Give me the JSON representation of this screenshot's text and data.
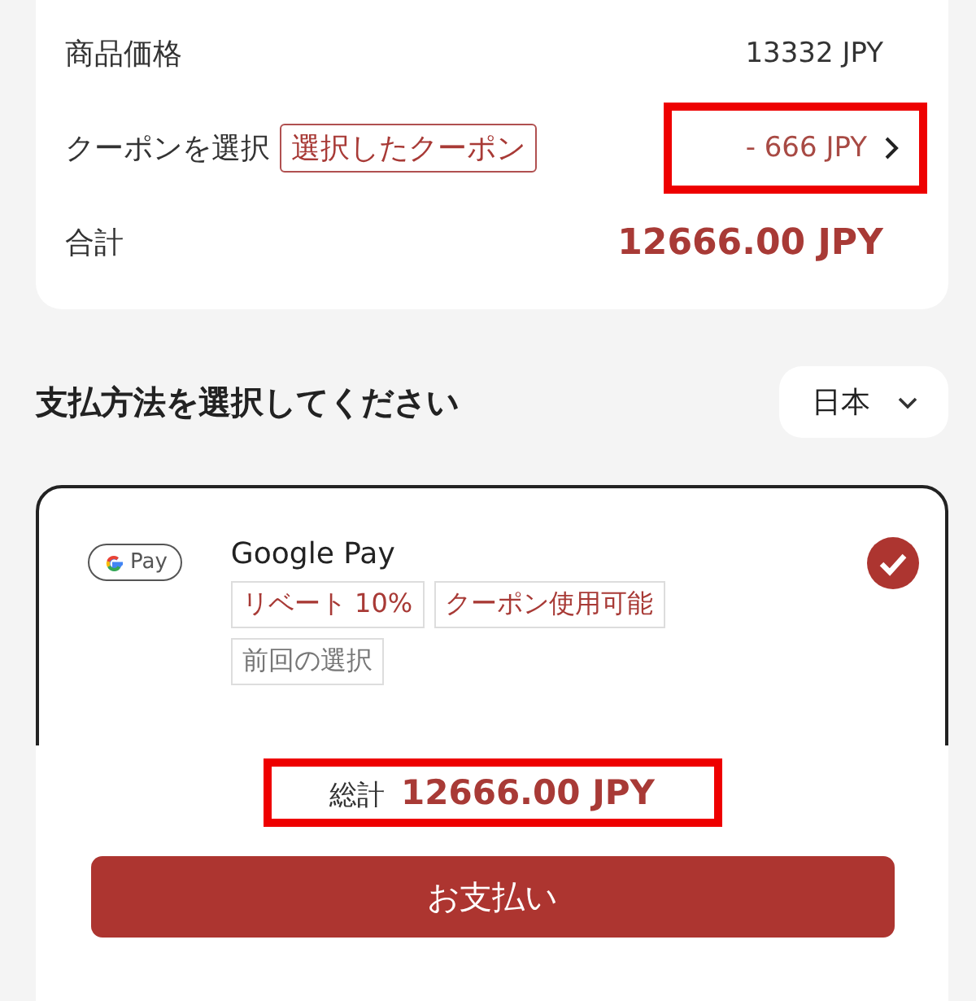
{
  "summary": {
    "rows": [
      {
        "kind": "plain",
        "label": "商品価格",
        "value": "13332 JPY"
      },
      {
        "kind": "coupon",
        "label": "クーポンを選択",
        "tag": "選択したクーポン",
        "value": "- 666 JPY",
        "highlighted": true
      },
      {
        "kind": "total",
        "label": "合計",
        "value": "12666.00 JPY"
      }
    ]
  },
  "payment_section": {
    "title": "支払方法を選択してください",
    "region": "日本",
    "methods": [
      {
        "name": "Google Pay",
        "logo_text": "Pay",
        "selected": true,
        "tags": [
          {
            "kind": "accent",
            "text": "リベート 10%"
          },
          {
            "kind": "accent",
            "text": "クーポン使用可能"
          },
          {
            "kind": "muted",
            "text": "前回の選択"
          }
        ]
      }
    ]
  },
  "footer": {
    "label": "総計",
    "amount": "12666.00 JPY",
    "highlighted": true,
    "button": "お支払い"
  }
}
